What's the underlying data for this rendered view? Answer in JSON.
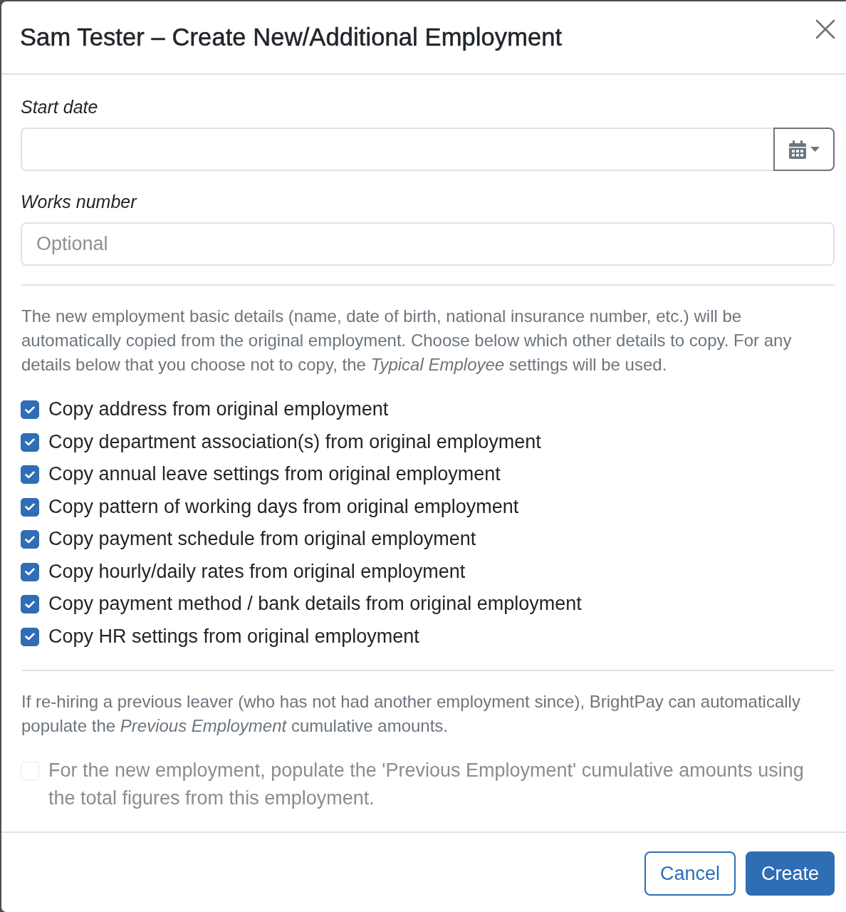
{
  "dialog": {
    "title": "Sam Tester – Create New/Additional Employment"
  },
  "fields": [
    {
      "label": "Start date",
      "kind": "date"
    },
    {
      "label": "Works number",
      "kind": "text",
      "placeholder": "Optional"
    }
  ],
  "copy_intro": "The new employment basic details (name, date of birth, national insurance number, etc.) will be automatically copied from the original employment. Choose below which other details to copy. For any details below that you choose not to copy, the *Typical Employee* settings will be used.",
  "copy_options": [
    {
      "label": "Copy address from original employment",
      "checked": true
    },
    {
      "label": "Copy department association(s) from original employment",
      "checked": true
    },
    {
      "label": "Copy annual leave settings from original employment",
      "checked": true
    },
    {
      "label": "Copy pattern of working days from original employment",
      "checked": true
    },
    {
      "label": "Copy payment schedule from original employment",
      "checked": true
    },
    {
      "label": "Copy hourly/daily rates from original employment",
      "checked": true
    },
    {
      "label": "Copy payment method / bank details from original employment",
      "checked": true
    },
    {
      "label": "Copy HR settings from original employment",
      "checked": true
    }
  ],
  "rehire_note": "If re-hiring a previous leaver (who has not had another employment since), BrightPay can automatically populate the *Previous Employment* cumulative amounts.",
  "rehire_option": {
    "label": "For the new employment, populate the 'Previous Employment' cumulative amounts using the total figures from this employment.",
    "checked": false,
    "disabled": true
  },
  "buttons": [
    {
      "label": "Cancel",
      "kind": "secondary"
    },
    {
      "label": "Create",
      "kind": "primary"
    }
  ]
}
